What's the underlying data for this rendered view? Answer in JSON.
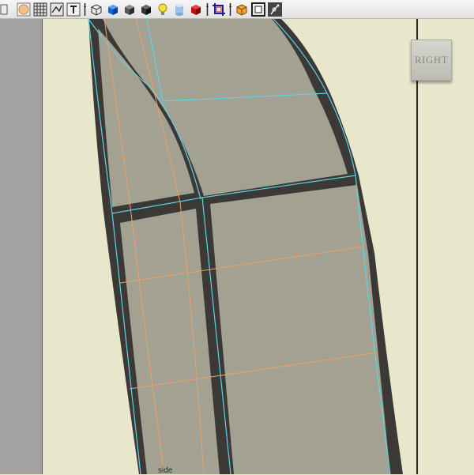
{
  "toolbar": {
    "icons": [
      "select-icon",
      "sphere-icon",
      "wireframe-grid-icon",
      "texture-view-icon",
      "text-tool-icon",
      "separator-handle-icon",
      "wireframe-cube-icon",
      "blue-shaded-cube-icon",
      "smooth-shaded-cube-icon",
      "flat-shaded-cube-icon",
      "light-bulb-icon",
      "blue-cylinder-icon",
      "red-cube-icon",
      "separator-handle-icon",
      "crop-icon",
      "separator-handle-icon",
      "orange-box-icon",
      "frame-icon",
      "skeleton-joint-icon"
    ]
  },
  "view_cube": {
    "label": "RIGHT"
  },
  "viewport": {
    "object_label": "side"
  },
  "colors": {
    "background": "#e8e6cb",
    "mesh_fill": "#a2a08f",
    "mesh_edge": "#3a3835",
    "wire_cyan": "#59d0e2",
    "wire_orange": "#e9a064",
    "gutter": "#a2a2a2"
  }
}
